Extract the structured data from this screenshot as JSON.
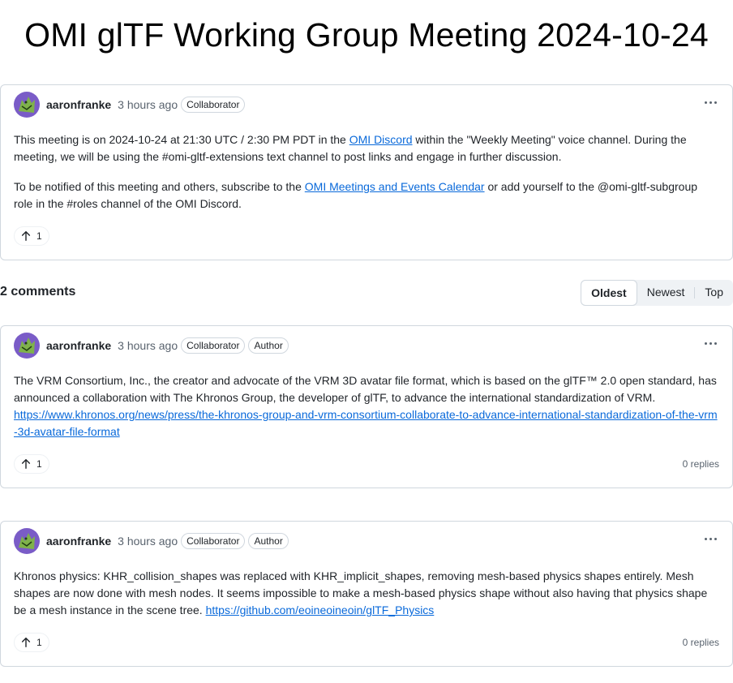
{
  "discussion": {
    "title": "OMI glTF Working Group Meeting 2024-10-24",
    "author": "aaronfranke",
    "time": "3 hours ago",
    "badges": [
      "Collaborator"
    ],
    "paragraph1": {
      "before": "This meeting is on 2024-10-24 at 21:30 UTC / 2:30 PM PDT in the ",
      "link": "OMI Discord",
      "after": " within the \"Weekly Meeting\" voice channel. During the meeting, we will be using the #omi-gltf-extensions text channel to post links and engage in further discussion."
    },
    "paragraph2": {
      "before": "To be notified of this meeting and others, subscribe to the ",
      "link": "OMI Meetings and Events Calendar",
      "after": " or add yourself to the @omi-gltf-subgroup role in the #roles channel of the OMI Discord."
    },
    "upvotes": "1"
  },
  "comments_header": {
    "count_label": "2 comments",
    "sort_options": [
      "Oldest",
      "Newest",
      "Top"
    ],
    "selected_sort": "Oldest"
  },
  "comments": [
    {
      "author": "aaronfranke",
      "time": "3 hours ago",
      "badges": [
        "Collaborator",
        "Author"
      ],
      "text": "The VRM Consortium, Inc., the creator and advocate of the VRM 3D avatar file format, which is based on the glTF™ 2.0 open standard, has announced a collaboration with The Khronos Group, the developer of glTF, to advance the international standardization of VRM.",
      "link": "https://www.khronos.org/news/press/the-khronos-group-and-vrm-consortium-collaborate-to-advance-international-standardization-of-the-vrm-3d-avatar-file-format",
      "upvotes": "1",
      "replies": "0 replies"
    },
    {
      "author": "aaronfranke",
      "time": "3 hours ago",
      "badges": [
        "Collaborator",
        "Author"
      ],
      "text": "Khronos physics: KHR_collision_shapes was replaced with KHR_implicit_shapes, removing mesh-based physics shapes entirely. Mesh shapes are now done with mesh nodes. It seems impossible to make a mesh-based physics shape without also having that physics shape be a mesh instance in the scene tree. ",
      "link": "https://github.com/eoineoineoin/glTF_Physics",
      "upvotes": "1",
      "replies": "0 replies"
    }
  ],
  "colors": {
    "link": "#0969da",
    "border": "#d0d7de",
    "muted": "#59636e",
    "avatar_bg": "#7a5cc7",
    "avatar_fg": "#7fb24a"
  },
  "icons": {
    "avatar": "avatar-image",
    "more": "kebab-horizontal-icon",
    "upvote": "arrow-up-icon"
  }
}
